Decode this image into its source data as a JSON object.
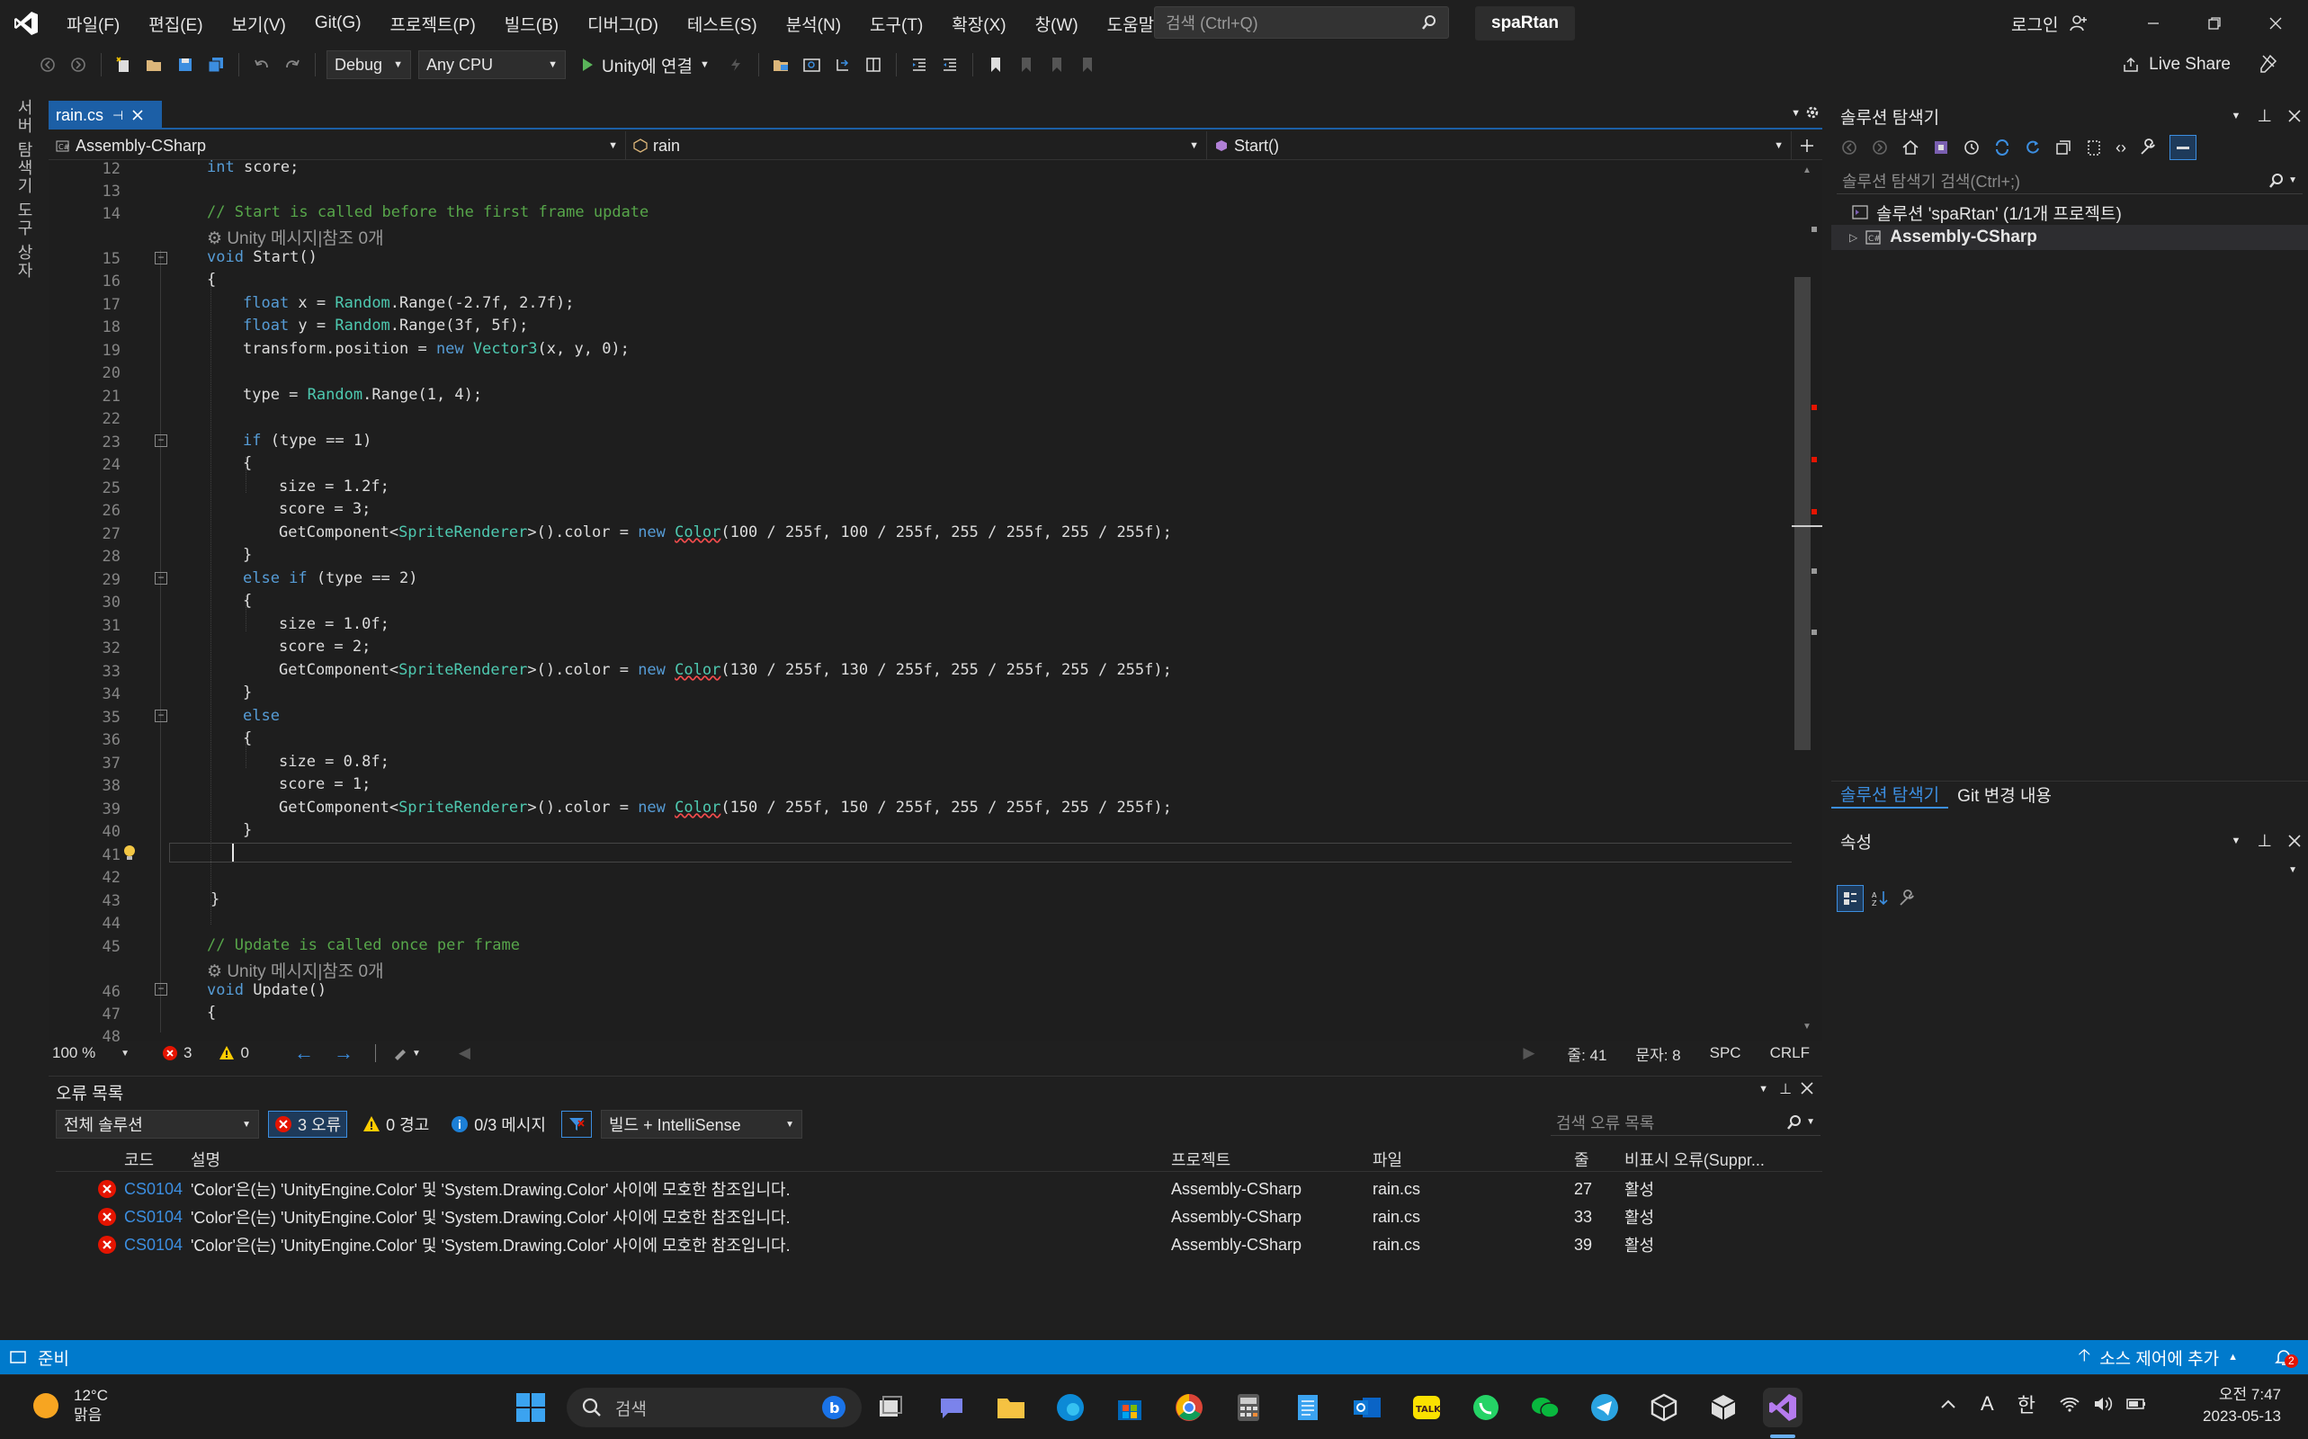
{
  "menu": [
    "파일(F)",
    "편집(E)",
    "보기(V)",
    "Git(G)",
    "프로젝트(P)",
    "빌드(B)",
    "디버그(D)",
    "테스트(S)",
    "분석(N)",
    "도구(T)",
    "확장(X)",
    "창(W)",
    "도움말(H)"
  ],
  "search": {
    "placeholder": "검색 (Ctrl+Q)"
  },
  "solution_name": "spaRtan",
  "login": "로그인",
  "toolbar": {
    "config": "Debug",
    "platform": "Any CPU",
    "run_label": "Unity에 연결",
    "liveshare": "Live Share"
  },
  "left_strip": {
    "server_explorer": "서버 탐색기",
    "toolbox": "도구 상자"
  },
  "editor": {
    "tab": "rain.cs",
    "nav_project": "Assembly-CSharp",
    "nav_class": "rain",
    "nav_member": "Start()",
    "lines": {
      "l12": "12",
      "l13": "13",
      "l14": "14",
      "l15": "15",
      "l16": "16",
      "l17": "17",
      "l18": "18",
      "l19": "19",
      "l20": "20",
      "l21": "21",
      "l22": "22",
      "l23": "23",
      "l24": "24",
      "l25": "25",
      "l26": "26",
      "l27": "27",
      "l28": "28",
      "l29": "29",
      "l30": "30",
      "l31": "31",
      "l32": "32",
      "l33": "33",
      "l34": "34",
      "l35": "35",
      "l36": "36",
      "l37": "37",
      "l38": "38",
      "l39": "39",
      "l40": "40",
      "l41": "41",
      "l42": "42",
      "l43": "43",
      "l44": "44",
      "l45": "45",
      "l46": "46",
      "l47": "47",
      "l48": "48"
    },
    "code": {
      "c12_kw": "int",
      "c12_rest": " score;",
      "c14": "// Start is called before the first frame update",
      "lens1": "Unity 메시지|참조 0개",
      "c15_kw": "void",
      "c15_rest": " Start()",
      "brace_open": "{",
      "brace_close": "}",
      "c17_kw": "float",
      "c17_a": " x = ",
      "c17_ty": "Random",
      "c17_b": ".Range(-2.7f, 2.7f);",
      "c18_kw": "float",
      "c18_a": " y = ",
      "c18_ty": "Random",
      "c18_b": ".Range(3f, 5f);",
      "c19_a": "transform.position = ",
      "c19_kw": "new",
      "c19_ty": " Vector3",
      "c19_b": "(x, y, 0);",
      "c21_a": "type = ",
      "c21_ty": "Random",
      "c21_b": ".Range(1, 4);",
      "c23_kw": "if",
      "c23_rest": " (type == 1)",
      "c25": "size = 1.2f;",
      "c26": "score = 3;",
      "getcomp": "GetComponent<",
      "sprite": "SpriteRenderer",
      "getcomp2": ">().color = ",
      "newkw": "new",
      "colorty": "Color",
      "c27_args": "(100 / 255f, 100 / 255f, 255 / 255f, 255 / 255f);",
      "c29_kw": "else if",
      "c29_rest": " (type == 2)",
      "c31": "size = 1.0f;",
      "c32": "score = 2;",
      "c33_args": "(130 / 255f, 130 / 255f, 255 / 255f, 255 / 255f);",
      "c35_kw": "else",
      "c37": "size = 0.8f;",
      "c38": "score = 1;",
      "c39_args": "(150 / 255f, 150 / 255f, 255 / 255f, 255 / 255f);",
      "c45": "// Update is called once per frame",
      "lens2": "Unity 메시지|참조 0개",
      "c46_kw": "void",
      "c46_rest": " Update()"
    },
    "status": {
      "zoom": "100 %",
      "errors": "3",
      "warnings": "0",
      "line": "줄: 41",
      "col": "문자: 8",
      "spc": "SPC",
      "crlf": "CRLF"
    }
  },
  "error_list": {
    "title": "오류 목록",
    "scope": "전체 솔루션",
    "errors_btn": "3 오류",
    "warnings_btn": "0 경고",
    "messages_btn": "0/3 메시지",
    "build_filter": "빌드 + IntelliSense",
    "search_placeholder": "검색 오류 목록",
    "columns": {
      "code": "코드",
      "desc": "설명",
      "project": "프로젝트",
      "file": "파일",
      "line": "줄",
      "suppress": "비표시 오류(Suppr..."
    },
    "rows": [
      {
        "code": "CS0104",
        "desc": "'Color'은(는) 'UnityEngine.Color' 및 'System.Drawing.Color' 사이에 모호한 참조입니다.",
        "project": "Assembly-CSharp",
        "file": "rain.cs",
        "line": "27",
        "state": "활성"
      },
      {
        "code": "CS0104",
        "desc": "'Color'은(는) 'UnityEngine.Color' 및 'System.Drawing.Color' 사이에 모호한 참조입니다.",
        "project": "Assembly-CSharp",
        "file": "rain.cs",
        "line": "33",
        "state": "활성"
      },
      {
        "code": "CS0104",
        "desc": "'Color'은(는) 'UnityEngine.Color' 및 'System.Drawing.Color' 사이에 모호한 참조입니다.",
        "project": "Assembly-CSharp",
        "file": "rain.cs",
        "line": "39",
        "state": "활성"
      }
    ]
  },
  "solution_explorer": {
    "title": "솔루션 탐색기",
    "search_placeholder": "솔루션 탐색기 검색(Ctrl+;)",
    "root": "솔루션 'spaRtan' (1/1개 프로젝트)",
    "project": "Assembly-CSharp",
    "tab_active": "솔루션 탐색기",
    "tab_git": "Git 변경 내용"
  },
  "properties": {
    "title": "속성"
  },
  "statusbar": {
    "ready": "준비",
    "source_control": "소스 제어에 추가",
    "notif_count": "2"
  },
  "taskbar": {
    "temp": "12°C",
    "weather": "맑음",
    "search": "검색",
    "ime_a": "A",
    "ime_han": "한",
    "time": "오전 7:47",
    "date": "2023-05-13"
  },
  "colors": {
    "accent": "#007acc",
    "error": "#e51400",
    "warning": "#ffcc00",
    "keyword": "#569cd6",
    "type": "#4ec9b0",
    "comment": "#57a64a"
  }
}
